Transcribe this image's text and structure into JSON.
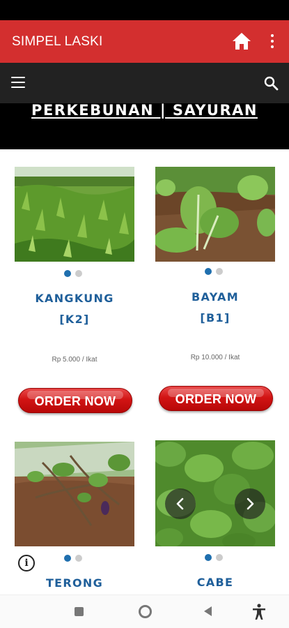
{
  "app_bar": {
    "title": "SIMPEL LASKI",
    "home_icon": "home-icon",
    "more_icon": "more-vert-icon"
  },
  "nav_bar": {
    "menu_icon": "hamburger-menu-icon",
    "search_icon": "search-icon"
  },
  "banner": {
    "title": "PERKEBUNAN | SAYURAN"
  },
  "products": [
    {
      "name_line1": "KANGKUNG",
      "name_line2": "[K2]",
      "price": "Rp 5.000 / Ikat",
      "order_label": "ORDER NOW",
      "slide_count": 2,
      "active_slide": 0
    },
    {
      "name_line1": "BAYAM",
      "name_line2": "[B1]",
      "price": "Rp 10.000 / Ikat",
      "order_label": "ORDER NOW",
      "slide_count": 2,
      "active_slide": 0
    },
    {
      "name_line1": "TERONG",
      "name_line2": "",
      "price": "",
      "order_label": "",
      "slide_count": 2,
      "active_slide": 0
    },
    {
      "name_line1": "CABE",
      "name_line2": "",
      "price": "",
      "order_label": "",
      "slide_count": 2,
      "active_slide": 0
    }
  ],
  "colors": {
    "app_bar": "#d32f2f",
    "nav_bar": "#222222",
    "product_name": "#1f5f9a",
    "order_button": "#d21414",
    "dot_active": "#1f6fae"
  },
  "info_icon": "info-icon",
  "system_nav": {
    "recents_icon": "recents-square-icon",
    "home_icon": "home-circle-icon",
    "back_icon": "back-triangle-icon",
    "accessibility_icon": "accessibility-icon"
  }
}
